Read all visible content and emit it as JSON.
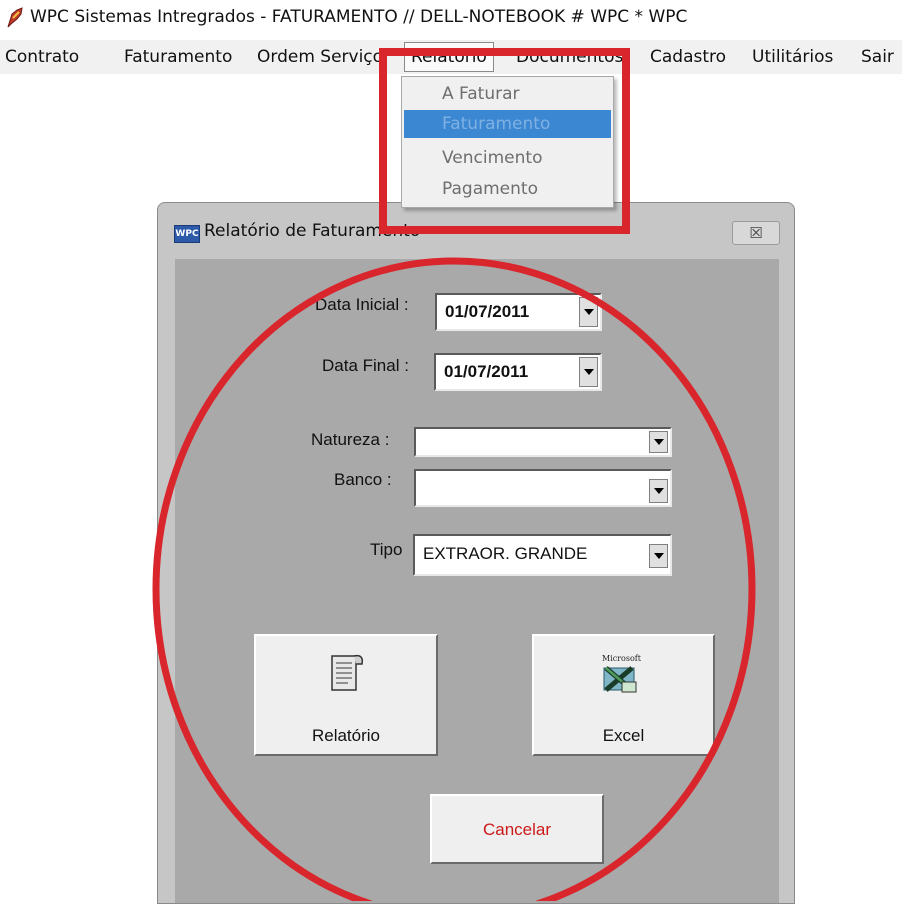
{
  "window": {
    "title": "WPC Sistemas Intregrados - FATURAMENTO // DELL-NOTEBOOK # WPC  * WPC",
    "icon": "wpc-app-icon"
  },
  "menubar": {
    "items": [
      {
        "label": "Contrato"
      },
      {
        "label": "Faturamento"
      },
      {
        "label": "Ordem Serviço"
      },
      {
        "label": "Relatório"
      },
      {
        "label": "Documentos"
      },
      {
        "label": "Cadastro"
      },
      {
        "label": "Utilitários"
      },
      {
        "label": "Sair"
      }
    ],
    "active": "Relatório"
  },
  "dropdown": {
    "items": [
      {
        "label": "A Faturar"
      },
      {
        "label": "Faturamento"
      },
      {
        "label": "Vencimento"
      },
      {
        "label": "Pagamento"
      }
    ],
    "selected": "Faturamento"
  },
  "dialog": {
    "title": "Relatório de Faturamento",
    "icon_text": "WPC",
    "close_symbol": "☒",
    "data_inicial": {
      "label": "Data Inicial :",
      "value": "01/07/2011"
    },
    "data_final": {
      "label": "Data Final :",
      "value": "01/07/2011"
    },
    "natureza": {
      "label": "Natureza :",
      "value": ""
    },
    "banco": {
      "label": "Banco :",
      "value": ""
    },
    "tipo": {
      "label": "Tipo",
      "value": "EXTRAOR. GRANDE"
    },
    "buttons": {
      "relatorio": "Relatório",
      "excel": "Excel",
      "excel_icon_caption": "Microsoft",
      "cancelar": "Cancelar"
    }
  },
  "annotations": {
    "color": "#d9262c"
  }
}
